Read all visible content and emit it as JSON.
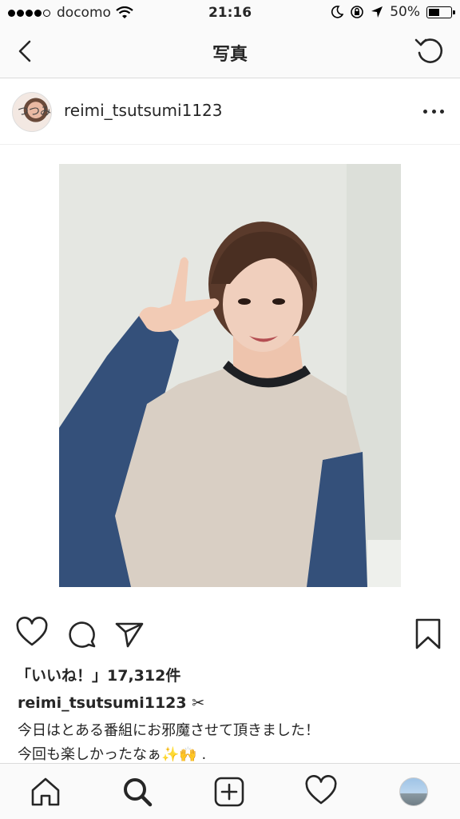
{
  "status_bar": {
    "carrier": "docomo",
    "time": "21:16",
    "battery": "50%",
    "battery_level": 0.5
  },
  "nav": {
    "title": "写真"
  },
  "post": {
    "username": "reimi_tsutsumi1123",
    "avatar_text": "つつみ",
    "likes": "「いいね！」17,312件",
    "caption_user": "reimi_tsutsumi1123",
    "caption_user_emoji": "✂",
    "caption_line1": "今日はとある番組にお邪魔させて頂きました！",
    "caption_line2": "今回も楽しかったなぁ✨🙌 ."
  },
  "icons": {
    "back": "chevron-left-icon",
    "refresh": "refresh-icon",
    "more": "more-horizontal-icon",
    "like": "heart-icon",
    "comment": "comment-icon",
    "share": "send-icon",
    "save": "bookmark-icon",
    "home": "home-icon",
    "search": "search-icon",
    "add": "add-post-icon",
    "activity": "heart-icon",
    "profile": "profile-avatar"
  },
  "colors": {
    "text": "#262626",
    "bar_background": "#fafafa",
    "divider": "#dbdbdb",
    "sweater": "#d9cfc4",
    "denim": "#34507a"
  }
}
